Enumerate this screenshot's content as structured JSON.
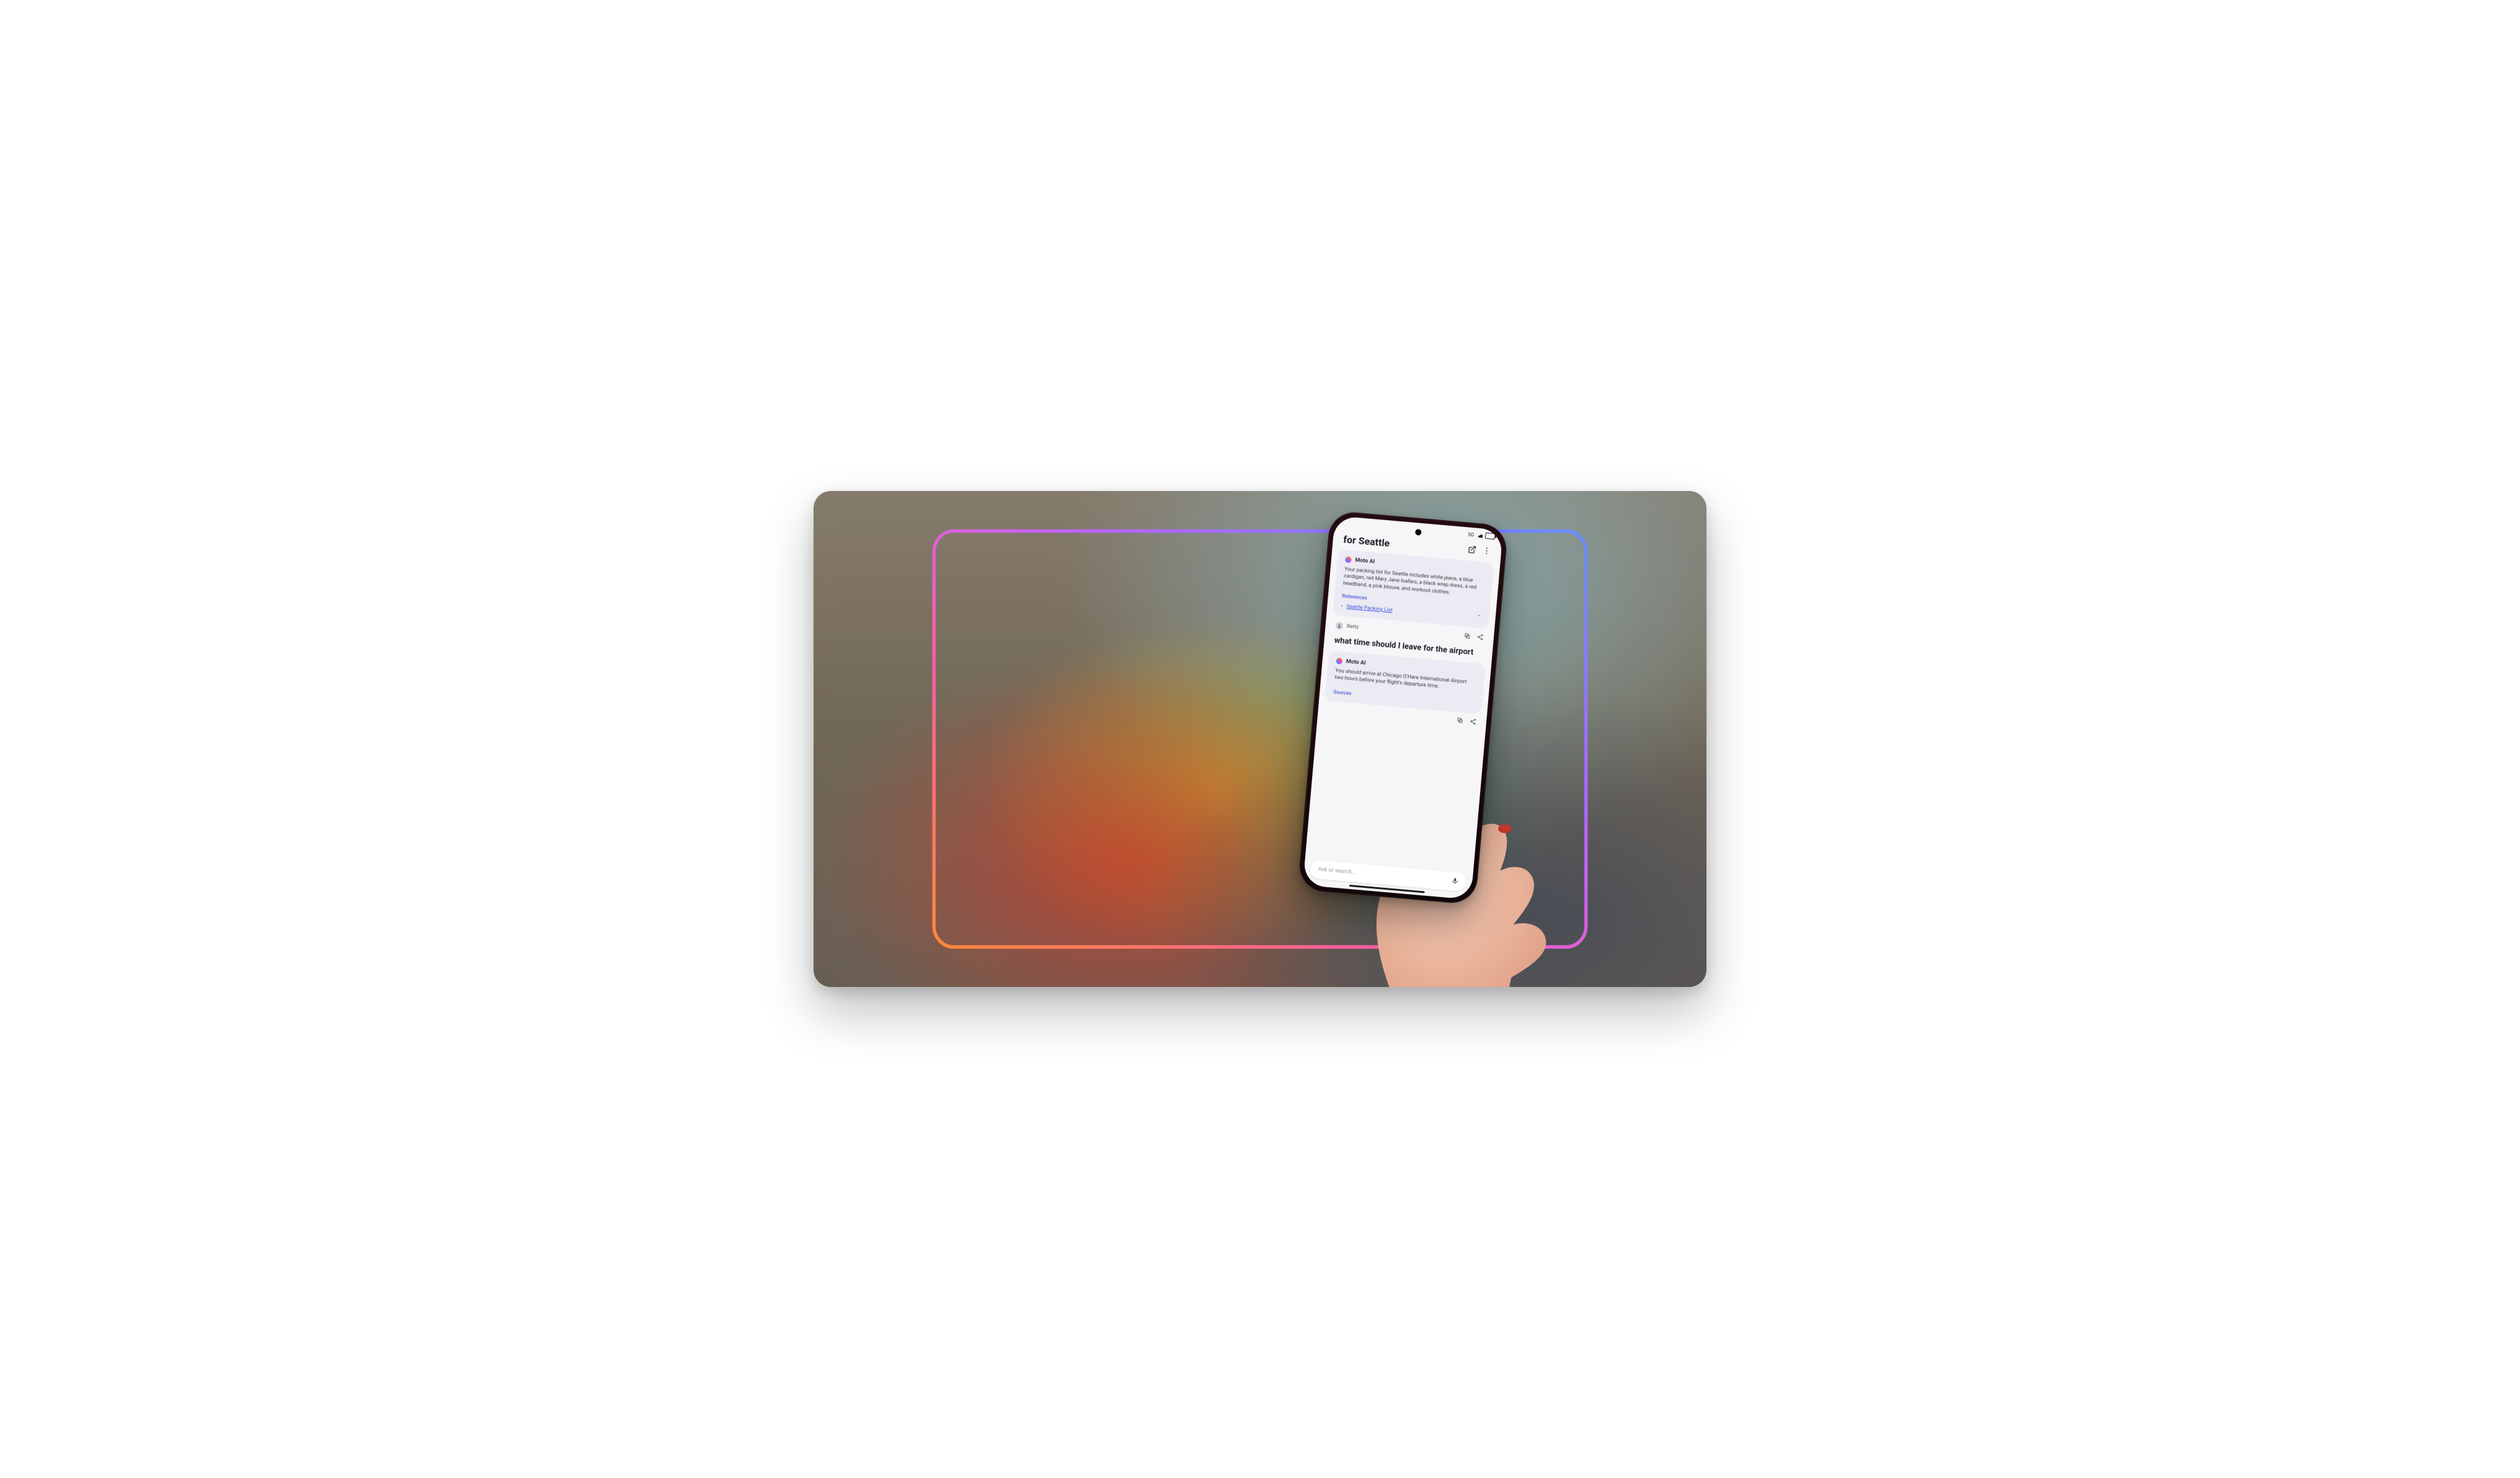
{
  "header": {
    "title": "for Seattle"
  },
  "status": {
    "network_label": "5G"
  },
  "cards": {
    "packing": {
      "ai_name": "Moto AI",
      "body": "Your packing list for Seattle includes white jeans, a blue cardigan, red Mary Jane loafers, a black wrap dress, a red headband, a pink blouse, and workout clothes.",
      "references_label": "References",
      "reference_link": "Seattle Packing List"
    },
    "user": {
      "name": "Betty",
      "question": "what time should I leave for the airport"
    },
    "airport": {
      "ai_name": "Moto AI",
      "body": "You should arrive at Chicago O'Hare International Airport two hours before your flight's departure time.",
      "sources_label": "Sources"
    }
  },
  "input": {
    "placeholder": "Ask or search..."
  }
}
